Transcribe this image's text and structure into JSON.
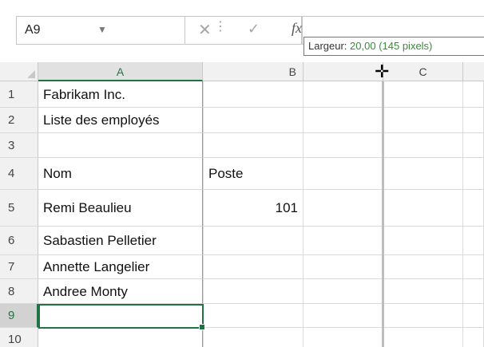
{
  "formula_bar": {
    "name_box": "A9",
    "name_box_arrow": "▼",
    "separator": "⋮",
    "cancel_icon": "✕",
    "enter_icon": "✓",
    "fx_label": "fx",
    "formula_value": ""
  },
  "tooltip": {
    "prefix": "Largeur: ",
    "value": "20,00 (145 pixels)"
  },
  "columns": [
    "A",
    "B",
    "C"
  ],
  "rows": [
    {
      "num": "1",
      "a": "Fabrikam Inc.",
      "b": ""
    },
    {
      "num": "2",
      "a": "Liste des employés",
      "b": ""
    },
    {
      "num": "3",
      "a": "",
      "b": ""
    },
    {
      "num": "4",
      "a": "Nom",
      "b": "Poste"
    },
    {
      "num": "5",
      "a": "Remi Beaulieu",
      "b": "101"
    },
    {
      "num": "6",
      "a": "Sabastien Pelletier",
      "b": ""
    },
    {
      "num": "7",
      "a": "Annette Langelier",
      "b": ""
    },
    {
      "num": "8",
      "a": "Andree Monty",
      "b": ""
    },
    {
      "num": "9",
      "a": "",
      "b": ""
    },
    {
      "num": "10",
      "a": "",
      "b": ""
    }
  ],
  "selected_cell": "A9",
  "resize_cursor_icon": "column-resize-cursor",
  "colors": {
    "accent": "#217346",
    "tooltip_value": "#3a8a3a"
  }
}
